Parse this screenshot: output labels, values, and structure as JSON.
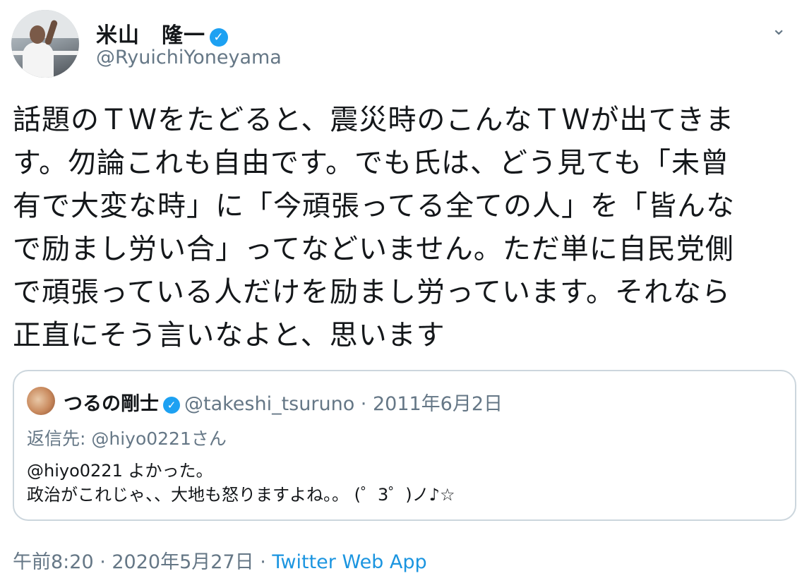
{
  "author": {
    "name": "米山　隆一",
    "handle": "@RyuichiYoneyama"
  },
  "tweet": {
    "text": "話題のＴＷをたどると、震災時のこんなＴＷが出てきま\nす。勿論これも自由です。でも氏は、どう見ても「未曾\n有で大変な時」に「今頑張ってる全ての人」を「皆んな\nで励まし労い合」ってなどいません。ただ単に自民党側\nで頑張っている人だけを励まし労っています。それなら\n正直にそう言いなよと、思います"
  },
  "quoted_tweet": {
    "name": "つるの剛士",
    "handle": "@takeshi_tsuruno",
    "date": " · 2011年6月2日",
    "replying_to": "返信先: @hiyo0221さん",
    "text": "@hiyo0221 よかった。\n政治がこれじゃ、、大地も怒りますよね。。 (゜3゜)ノ♪☆"
  },
  "meta": {
    "time_date": "午前8:20 · 2020年5月27日 · ",
    "source": "Twitter Web App"
  },
  "icons": {
    "verified": "✓",
    "caret": "⌄"
  }
}
